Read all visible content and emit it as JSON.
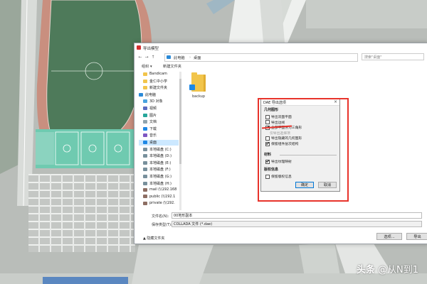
{
  "dialog": {
    "title": "导出模型",
    "breadcrumb": [
      "此电脑",
      "桌面"
    ],
    "search_placeholder": "搜索\"桌面\"",
    "toolbar": {
      "organize": "组织 ▾",
      "new_folder": "新建文件夹"
    },
    "sidebar": [
      {
        "label": "Bandicam",
        "icon": "folder"
      },
      {
        "label": "金仁中小学",
        "icon": "folder"
      },
      {
        "label": "新建文件夹",
        "icon": "folder"
      },
      {
        "label": "此电脑",
        "icon": "pc"
      },
      {
        "label": "3D 对象",
        "icon": "cube"
      },
      {
        "label": "视频",
        "icon": "video"
      },
      {
        "label": "图片",
        "icon": "picture"
      },
      {
        "label": "文档",
        "icon": "document"
      },
      {
        "label": "下载",
        "icon": "download"
      },
      {
        "label": "音乐",
        "icon": "music"
      },
      {
        "label": "桌面",
        "icon": "desktop",
        "selected": true
      },
      {
        "label": "本地磁盘 (C:)",
        "icon": "drive"
      },
      {
        "label": "本地磁盘 (D:)",
        "icon": "drive"
      },
      {
        "label": "本地磁盘 (E:)",
        "icon": "drive"
      },
      {
        "label": "本地磁盘 (F:)",
        "icon": "drive"
      },
      {
        "label": "本地磁盘 (G:)",
        "icon": "drive"
      },
      {
        "label": "本地磁盘 (H:)",
        "icon": "drive"
      },
      {
        "label": "mail (\\\\192.168",
        "icon": "network-drive"
      },
      {
        "label": "public (\\\\192.1",
        "icon": "network-drive"
      },
      {
        "label": "private (\\\\192.",
        "icon": "network-drive"
      }
    ],
    "files": [
      {
        "name": "backup",
        "icon": "folder-shortcut"
      }
    ],
    "filename_label": "文件名(N):",
    "filename_value": "00地形副本",
    "filetype_label": "保存类型(T):",
    "filetype_value": "COLLADA 文件 (*.dae)",
    "hide_folders": "▲ 隐藏文件夹",
    "options_button": "选项...",
    "export_button": "导出"
  },
  "options_dialog": {
    "title": "DAE 导出选项",
    "close": "×",
    "geometry_header": "几何图形",
    "geometry_options": [
      {
        "label": "导出双面平面",
        "checked": false,
        "disabled": false
      },
      {
        "label": "导出边线",
        "checked": false,
        "disabled": false
      },
      {
        "label": "全部平面分为三角形",
        "checked": true,
        "disabled": false
      },
      {
        "label": "仅导出选择项",
        "checked": false,
        "disabled": true
      },
      {
        "label": "导出隐藏的几何图形",
        "checked": false,
        "disabled": false
      },
      {
        "label": "保留组件层次结构",
        "checked": true,
        "disabled": false
      }
    ],
    "materials_header": "材料",
    "materials_options": [
      {
        "label": "导出纹理映射",
        "checked": true,
        "disabled": false
      }
    ],
    "credits_header": "版权信息",
    "credits_options": [
      {
        "label": "保留版权信息",
        "checked": false,
        "disabled": false
      }
    ],
    "ok_button": "确定",
    "cancel_button": "取消"
  },
  "watermark": {
    "prefix": "头条",
    "handle": "@从N到1"
  },
  "colors": {
    "highlight": "#e8332b",
    "selection": "#cce8ff",
    "accent": "#0078d7"
  }
}
